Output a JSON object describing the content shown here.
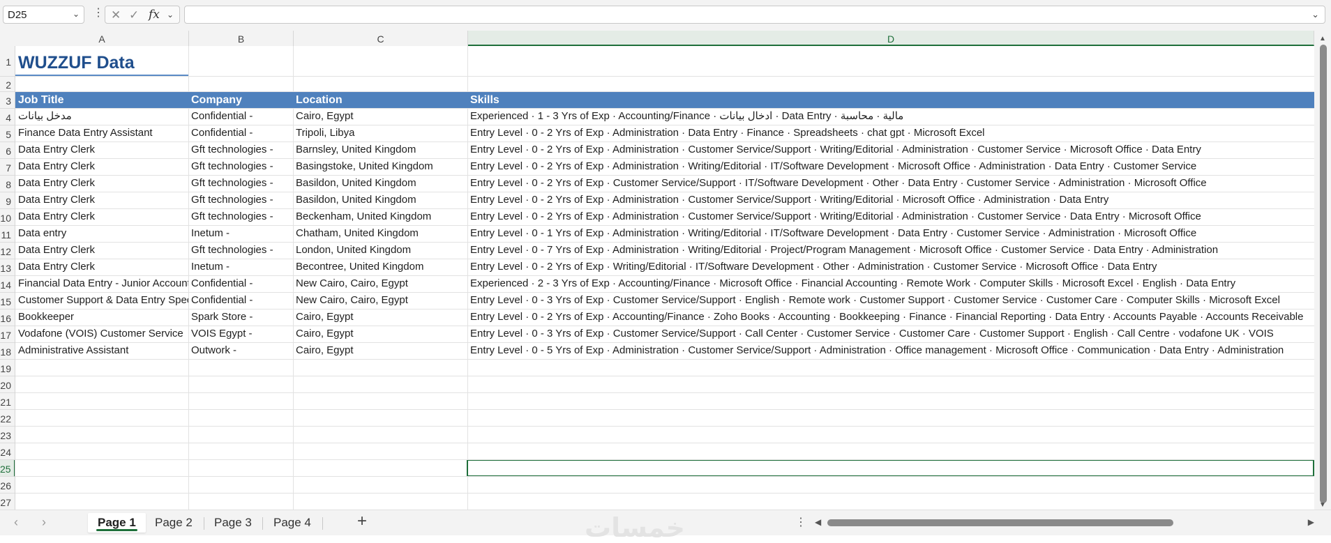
{
  "formula_bar": {
    "name_box": "D25",
    "fx_label": "fx",
    "formula": ""
  },
  "columns": [
    "A",
    "B",
    "C",
    "D"
  ],
  "selected_column": "D",
  "row_numbers": [
    "1",
    "2",
    "3",
    "4",
    "5",
    "6",
    "7",
    "8",
    "9",
    "10",
    "11",
    "12",
    "13",
    "14",
    "15",
    "16",
    "17",
    "18",
    "19",
    "20",
    "21",
    "22",
    "23",
    "24",
    "25",
    "26",
    "27"
  ],
  "selected_row": "25",
  "sheet": {
    "title": "WUZZUF Data",
    "headers": [
      "Job Title",
      "Company",
      "Location",
      "Skills"
    ],
    "rows": [
      [
        "مدخل بيانات",
        "Confidential -",
        "Cairo, Egypt",
        "Experienced · 1 - 3 Yrs of Exp · Accounting/Finance · ادخال بيانات · Data Entry · مالية · محاسبة"
      ],
      [
        "Finance Data Entry Assistant",
        "Confidential -",
        "Tripoli, Libya",
        "Entry Level · 0 - 2 Yrs of Exp · Administration · Data Entry · Finance · Spreadsheets · chat gpt · Microsoft Excel"
      ],
      [
        "Data Entry Clerk",
        "Gft technologies -",
        "Barnsley, United Kingdom",
        "Entry Level · 0 - 2 Yrs of Exp · Administration · Customer Service/Support · Writing/Editorial · Administration · Customer Service · Microsoft Office · Data Entry"
      ],
      [
        "Data Entry Clerk",
        "Gft technologies -",
        "Basingstoke, United Kingdom",
        "Entry Level · 0 - 2 Yrs of Exp · Administration · Writing/Editorial · IT/Software Development · Microsoft Office · Administration · Data Entry · Customer Service"
      ],
      [
        "Data Entry Clerk",
        "Gft technologies -",
        "Basildon, United Kingdom",
        "Entry Level · 0 - 2 Yrs of Exp · Customer Service/Support · IT/Software Development · Other · Data Entry · Customer Service · Administration · Microsoft Office"
      ],
      [
        "Data Entry Clerk",
        "Gft technologies -",
        "Basildon, United Kingdom",
        "Entry Level · 0 - 2 Yrs of Exp · Administration · Customer Service/Support · Writing/Editorial · Microsoft Office · Administration · Data Entry"
      ],
      [
        "Data Entry Clerk",
        "Gft technologies -",
        "Beckenham, United Kingdom",
        "Entry Level · 0 - 2 Yrs of Exp · Administration · Customer Service/Support · Writing/Editorial · Administration · Customer Service · Data Entry · Microsoft Office"
      ],
      [
        "Data entry",
        "Inetum -",
        "Chatham, United Kingdom",
        "Entry Level · 0 - 1 Yrs of Exp · Administration · Writing/Editorial · IT/Software Development · Data Entry · Customer Service · Administration · Microsoft Office"
      ],
      [
        "Data Entry Clerk",
        "Gft technologies -",
        "London, United Kingdom",
        "Entry Level · 0 - 7 Yrs of Exp · Administration · Writing/Editorial · Project/Program Management · Microsoft Office · Customer Service · Data Entry · Administration"
      ],
      [
        "Data Entry Clerk",
        "Inetum -",
        "Becontree, United Kingdom",
        "Entry Level · 0 - 2 Yrs of Exp · Writing/Editorial · IT/Software Development · Other · Administration · Customer Service · Microsoft Office · Data Entry"
      ],
      [
        "Financial Data Entry - Junior Accountant",
        "Confidential -",
        "New Cairo, Cairo, Egypt",
        "Experienced · 2 - 3 Yrs of Exp · Accounting/Finance · Microsoft Office · Financial Accounting · Remote Work · Computer Skills · Microsoft Excel · English · Data Entry"
      ],
      [
        "Customer Support & Data Entry Specialist",
        "Confidential -",
        "New Cairo, Cairo, Egypt",
        "Entry Level · 0 - 3 Yrs of Exp · Customer Service/Support · English · Remote work · Customer Support · Customer Service · Customer Care · Computer Skills · Microsoft Excel"
      ],
      [
        "Bookkeeper",
        "Spark Store -",
        "Cairo, Egypt",
        "Entry Level · 0 - 2 Yrs of Exp · Accounting/Finance · Zoho Books · Accounting · Bookkeeping · Finance · Financial Reporting · Data Entry · Accounts Payable · Accounts Receivable"
      ],
      [
        "Vodafone (VOIS) Customer Service",
        "VOIS Egypt -",
        "Cairo, Egypt",
        "Entry Level · 0 - 3 Yrs of Exp · Customer Service/Support · Call Center · Customer Service · Customer Care · Customer Support · English · Call Centre · vodafone UK · VOIS"
      ],
      [
        "Administrative Assistant",
        "Outwork -",
        "Cairo, Egypt",
        "Entry Level · 0 - 5 Yrs of Exp · Administration · Customer Service/Support · Administration · Office management · Microsoft Office · Communication · Data Entry · Administration"
      ]
    ]
  },
  "sheet_tabs": [
    "Page 1",
    "Page 2",
    "Page 3",
    "Page 4"
  ],
  "active_tab": "Page 1",
  "watermark": "خمسات",
  "colors": {
    "header_band": "#4f81bd",
    "title_text": "#1f4e8c",
    "selection_green": "#1e6f3a"
  }
}
